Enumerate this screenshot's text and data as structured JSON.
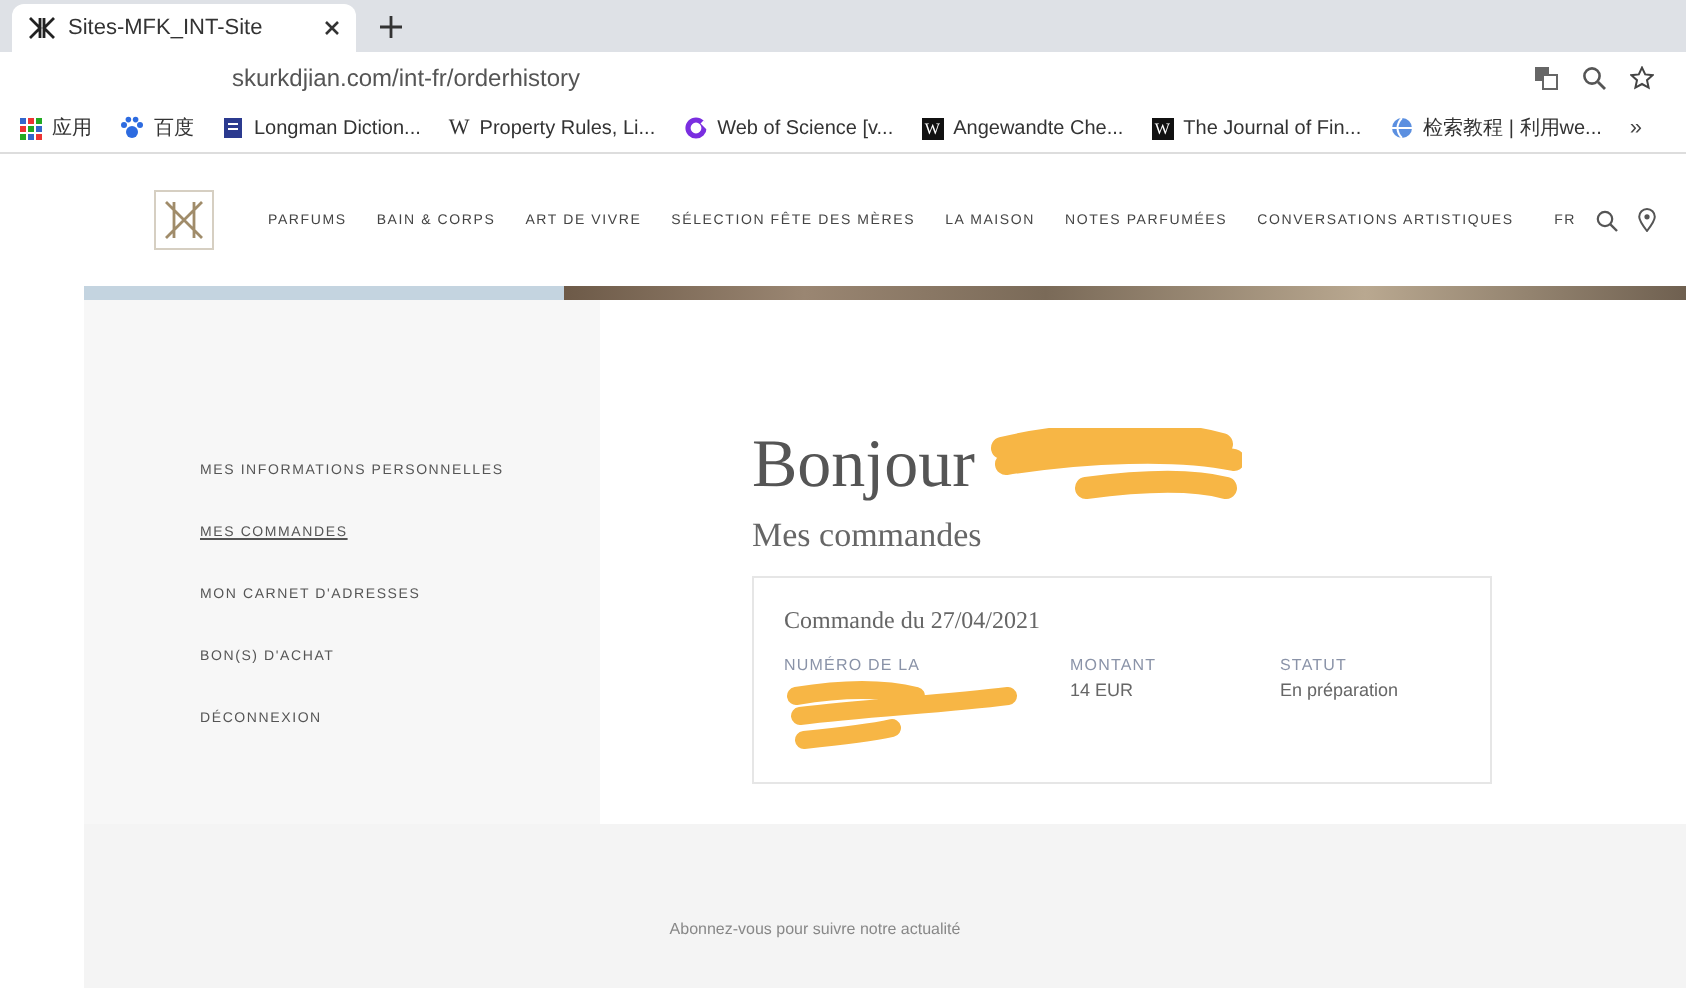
{
  "browser": {
    "tab_title": "Sites-MFK_INT-Site",
    "url": "skurkdjian.com/int-fr/orderhistory",
    "bookmarks": [
      {
        "label": "应用",
        "kind": "apps"
      },
      {
        "label": "百度",
        "kind": "paw"
      },
      {
        "label": "Longman Diction...",
        "kind": "book"
      },
      {
        "label": "Property Rules, Li...",
        "kind": "w",
        "icon_text": "W"
      },
      {
        "label": "Web of Science [v...",
        "kind": "ring"
      },
      {
        "label": "Angewandte Che...",
        "kind": "wbox",
        "icon_text": "W"
      },
      {
        "label": "The Journal of Fin...",
        "kind": "wbox",
        "icon_text": "W"
      },
      {
        "label": "检索教程 | 利用we...",
        "kind": "globe"
      }
    ],
    "more": "»"
  },
  "site": {
    "nav": [
      "PARFUMS",
      "BAIN & CORPS",
      "ART DE VIVRE",
      "SÉLECTION FÊTE DES MÈRES",
      "LA MAISON",
      "NOTES PARFUMÉES",
      "CONVERSATIONS ARTISTIQUES"
    ],
    "language": "FR"
  },
  "sidebar": {
    "items": [
      {
        "label": "MES INFORMATIONS PERSONNELLES",
        "selected": false
      },
      {
        "label": "MES COMMANDES",
        "selected": true
      },
      {
        "label": "MON CARNET D'ADRESSES",
        "selected": false
      },
      {
        "label": "BON(S) D'ACHAT",
        "selected": false
      },
      {
        "label": "DÉCONNEXION",
        "selected": false
      }
    ]
  },
  "account": {
    "greeting": "Bonjour",
    "section_title": "Mes commandes",
    "order": {
      "title": "Commande du 27/04/2021",
      "fields": [
        {
          "label": "NUMÉRO DE LA"
        },
        {
          "label": "MONTANT",
          "value": "14 EUR"
        },
        {
          "label": "STATUT",
          "value": "En préparation"
        }
      ]
    }
  },
  "footer": {
    "subtitle": "Abonnez-vous pour suivre notre actualité"
  }
}
